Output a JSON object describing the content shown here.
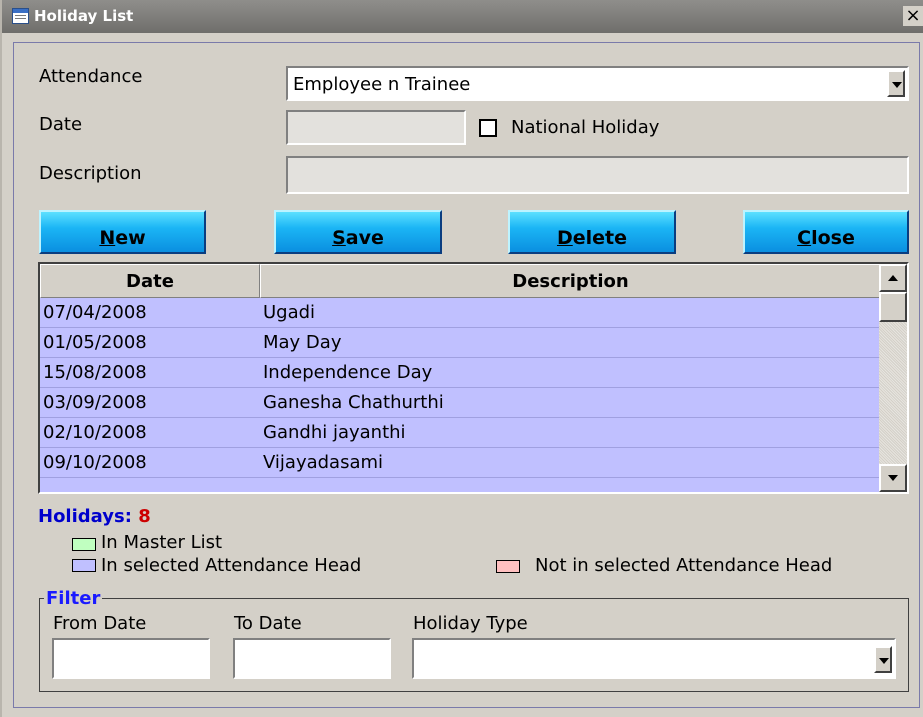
{
  "window": {
    "title": "Holiday List",
    "close_glyph": "×"
  },
  "form": {
    "attendance_label": "Attendance",
    "attendance_value": "Employee n Trainee",
    "date_label": "Date",
    "date_value": "",
    "national_holiday_label": "National Holiday",
    "national_holiday_checked": false,
    "description_label": "Description",
    "description_value": ""
  },
  "buttons": {
    "new_hotkey": "N",
    "new_rest": "ew",
    "save_hotkey": "S",
    "save_rest": "ave",
    "delete_hotkey": "D",
    "delete_rest": "elete",
    "close_hotkey": "C",
    "close_rest": "lose"
  },
  "grid": {
    "columns": [
      "Date",
      "Description"
    ],
    "rows": [
      {
        "date": "07/04/2008",
        "description": "Ugadi"
      },
      {
        "date": "01/05/2008",
        "description": "May Day"
      },
      {
        "date": "15/08/2008",
        "description": "Independence Day"
      },
      {
        "date": "03/09/2008",
        "description": "Ganesha Chathurthi"
      },
      {
        "date": "02/10/2008",
        "description": "Gandhi jayanthi"
      },
      {
        "date": "09/10/2008",
        "description": "Vijayadasami"
      }
    ],
    "row_color": "#c0c0ff"
  },
  "summary": {
    "label": "Holidays:",
    "count": "8",
    "label_color": "#0000cc",
    "count_color": "#cc0000"
  },
  "legend": {
    "master": {
      "label": "In Master List",
      "color": "#c0ffc0"
    },
    "selected": {
      "label": "In selected Attendance Head",
      "color": "#c0c0ff"
    },
    "not_selected": {
      "label": "Not in selected Attendance Head",
      "color": "#ffc0c0"
    }
  },
  "filter": {
    "title": "Filter",
    "from_date_label": "From Date",
    "to_date_label": "To Date",
    "holiday_type_label": "Holiday Type",
    "from_date_value": "",
    "to_date_value": "",
    "holiday_type_value": ""
  }
}
